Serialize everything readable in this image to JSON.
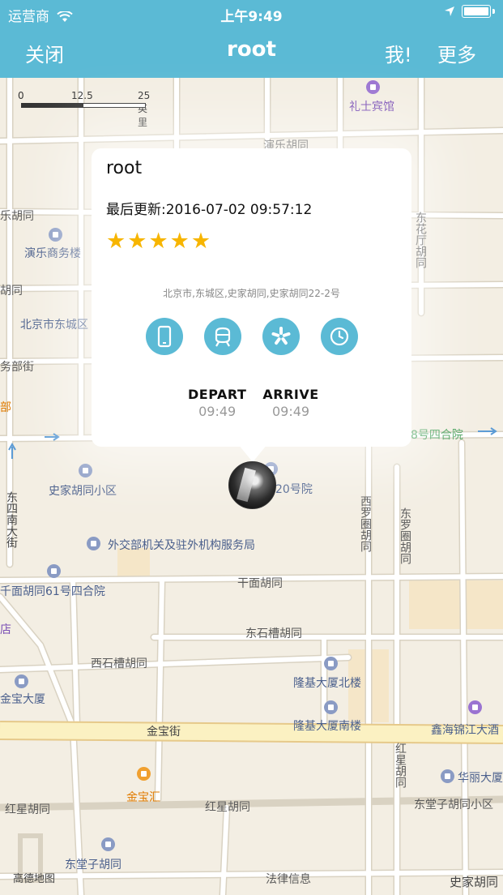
{
  "status_bar": {
    "carrier": "运营商",
    "time": "上午9:49"
  },
  "nav": {
    "close_label": "关闭",
    "title": "root",
    "me_label": "我!",
    "more_label": "更多"
  },
  "map": {
    "scale": {
      "zero": "0",
      "mid": "12.5",
      "end": "25 英里"
    },
    "labels": [
      "礼士宾馆",
      "演乐胡同",
      "乐胡同",
      "演乐商务楼",
      "东花厅胡同",
      "胡同",
      "北京市东城区",
      "务部街",
      "部",
      "史家胡同小区",
      "20号院",
      "东四南大街",
      "外交部机关及驻外机构服务局",
      "西罗圈胡同",
      "东罗圈胡同",
      "千面胡同61号四合院",
      "干面胡同",
      "店",
      "东石槽胡同",
      "西石槽胡同",
      "金宝大厦",
      "隆基大厦北楼",
      "隆基大厦南楼",
      "金宝街",
      "鑫海锦江大酒",
      "红星胡同",
      "华丽大厦",
      "金宝汇",
      "红星胡同",
      "红星胡同",
      "东堂子胡同小区",
      "东堂子胡同",
      "法律信息",
      "高德地图",
      "史家胡同",
      "8号四合院"
    ]
  },
  "popup": {
    "name": "root",
    "last_update": "最后更新:2016-07-02 09:57:12",
    "rating": 5,
    "address": "北京市,东城区,史家胡同,史家胡同22-2号",
    "actions": [
      "phone-icon",
      "transit-icon",
      "yelp-icon",
      "clock-icon"
    ],
    "depart_label": "DEPART",
    "depart_time": "09:49",
    "arrive_label": "ARRIVE",
    "arrive_time": "09:49"
  },
  "colors": {
    "accent": "#5bbad5",
    "star": "#f7b500",
    "map_bg": "#f3eee3",
    "road": "#ffffff",
    "main_road": "#fbf1c2"
  }
}
